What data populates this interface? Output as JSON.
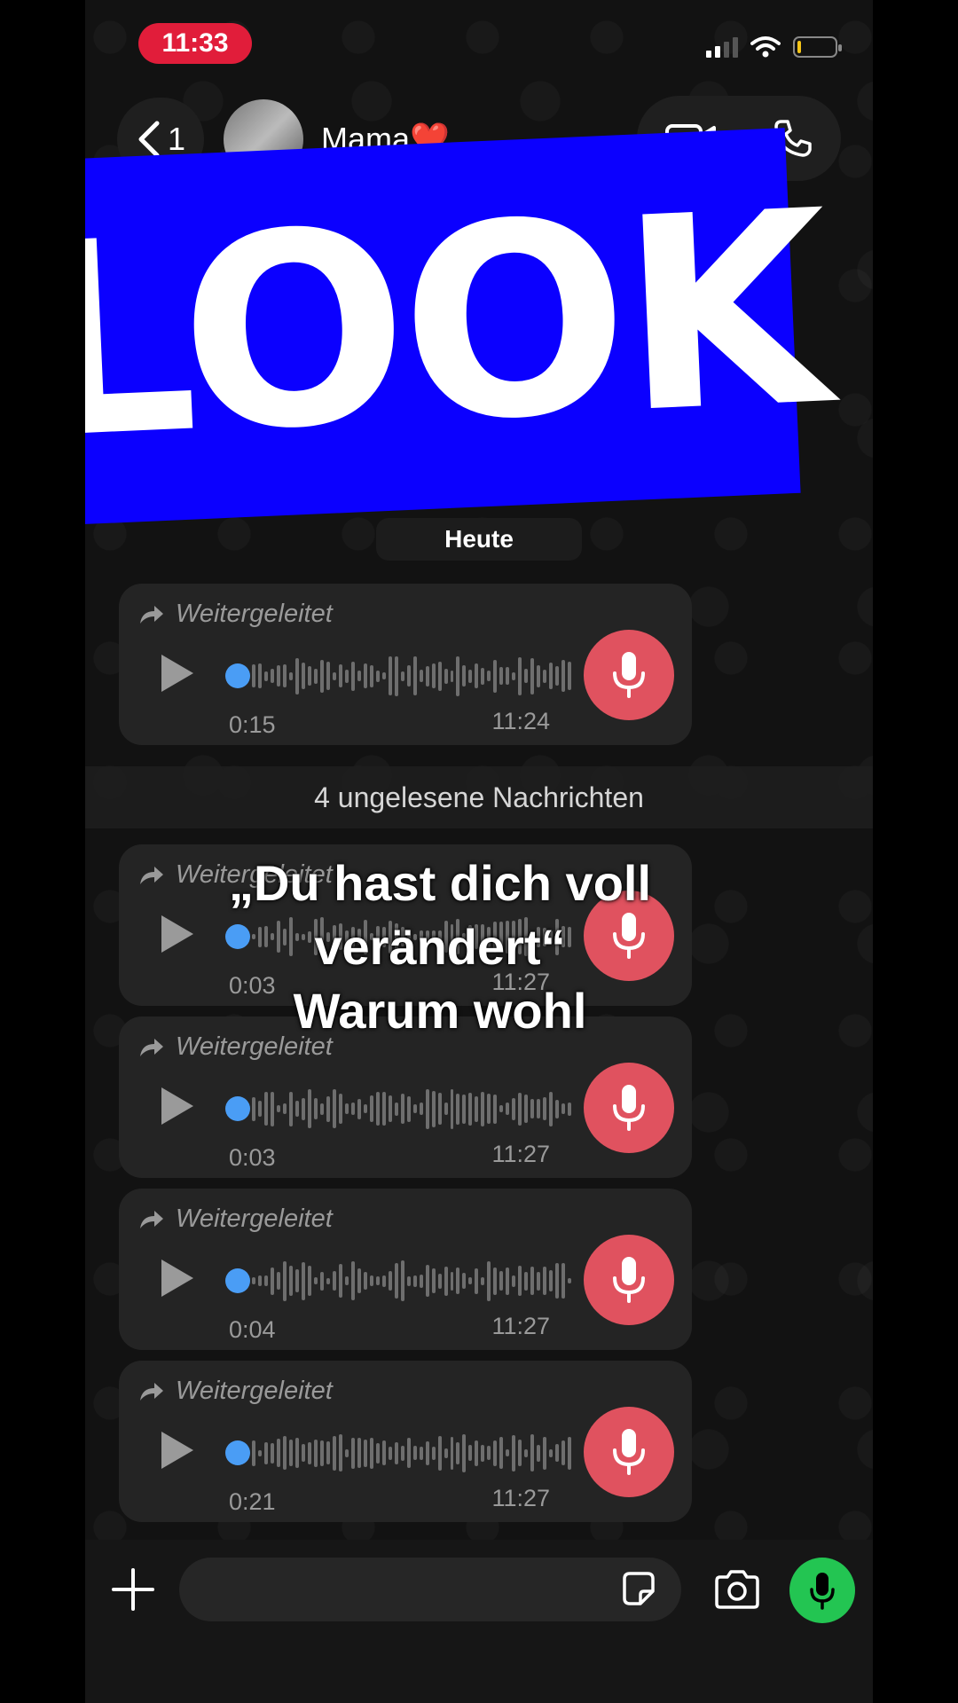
{
  "status_bar": {
    "time": "11:33"
  },
  "header": {
    "back_count": "1",
    "contact_name": "Mama",
    "contact_emoji": "❤️"
  },
  "sticker": {
    "text": "LOOK",
    "background": "#0b00ff"
  },
  "date_chip": "Heute",
  "unread_banner": "4 ungelesene Nachrichten",
  "forwarded_label": "Weitergeleitet",
  "messages": [
    {
      "forwarded": "Weitergeleitet",
      "duration": "0:15",
      "time": "11:24",
      "progress": 0
    },
    {
      "forwarded": "Weitergeleitet",
      "duration": "0:03",
      "time": "11:27",
      "progress": 0
    },
    {
      "forwarded": "Weitergeleitet",
      "duration": "0:03",
      "time": "11:27",
      "progress": 0
    },
    {
      "forwarded": "Weitergeleitet",
      "duration": "0:04",
      "time": "11:27",
      "progress": 0
    },
    {
      "forwarded": "Weitergeleitet",
      "duration": "0:21",
      "time": "11:27",
      "progress": 0
    }
  ],
  "caption": "„Du hast dich voll\nverändert“\nWarum wohl",
  "colors": {
    "status_time_bg": "#e11d3a",
    "mic_badge": "#e0525f",
    "send_mic": "#23c552",
    "progress_dot": "#4a9df5"
  },
  "icons": [
    "back-chevron-icon",
    "video-call-icon",
    "phone-icon",
    "forward-icon",
    "play-icon",
    "microphone-icon",
    "plus-icon",
    "sticker-icon",
    "camera-icon"
  ]
}
